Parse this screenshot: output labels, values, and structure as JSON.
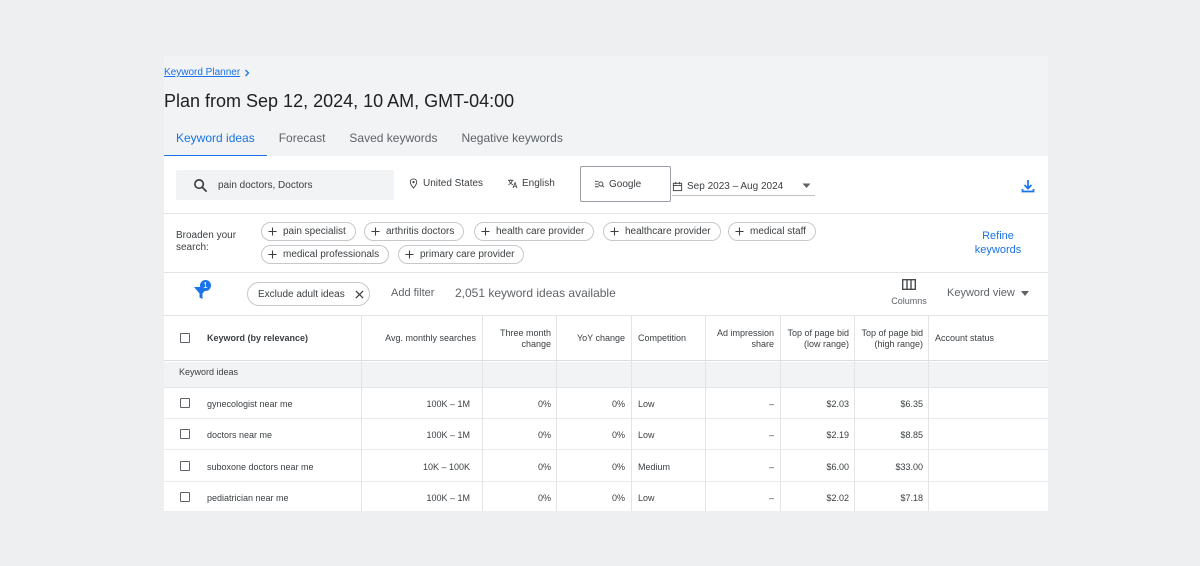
{
  "breadcrumb": {
    "label": "Keyword Planner"
  },
  "title": "Plan from Sep 12, 2024, 10 AM, GMT-04:00",
  "tabs": [
    "Keyword ideas",
    "Forecast",
    "Saved keywords",
    "Negative keywords"
  ],
  "search": {
    "value": "pain doctors, Doctors"
  },
  "location": "United States",
  "language": "English",
  "network": "Google",
  "date_range": "Sep 2023 – Aug 2024",
  "broaden": {
    "label": "Broaden your search:",
    "chips": [
      "pain specialist",
      "arthritis doctors",
      "health care provider",
      "healthcare provider",
      "medical staff",
      "medical professionals",
      "primary care provider"
    ]
  },
  "refine": "Refine keywords",
  "filter": {
    "badge": "1",
    "exclude_chip": "Exclude adult ideas",
    "add_filter": "Add filter",
    "available": "2,051 keyword ideas available",
    "columns": "Columns",
    "view": "Keyword view"
  },
  "table": {
    "headers": [
      "Keyword (by relevance)",
      "Avg. monthly searches",
      "Three month change",
      "YoY change",
      "Competition",
      "Ad impression share",
      "Top of page bid (low range)",
      "Top of page bid (high range)",
      "Account status"
    ],
    "group_label": "Keyword ideas",
    "rows": [
      [
        "gynecologist near me",
        "100K – 1M",
        "0%",
        "0%",
        "Low",
        "–",
        "$2.03",
        "$6.35",
        ""
      ],
      [
        "doctors near me",
        "100K – 1M",
        "0%",
        "0%",
        "Low",
        "–",
        "$2.19",
        "$8.85",
        ""
      ],
      [
        "suboxone doctors near me",
        "10K – 100K",
        "0%",
        "0%",
        "Medium",
        "–",
        "$6.00",
        "$33.00",
        ""
      ],
      [
        "pediatrician near me",
        "100K – 1M",
        "0%",
        "0%",
        "Low",
        "–",
        "$2.02",
        "$7.18",
        ""
      ]
    ]
  },
  "colors": {
    "accent": "#1a73e8",
    "background": "#eeeff1",
    "panel": "#f1f3f4"
  }
}
